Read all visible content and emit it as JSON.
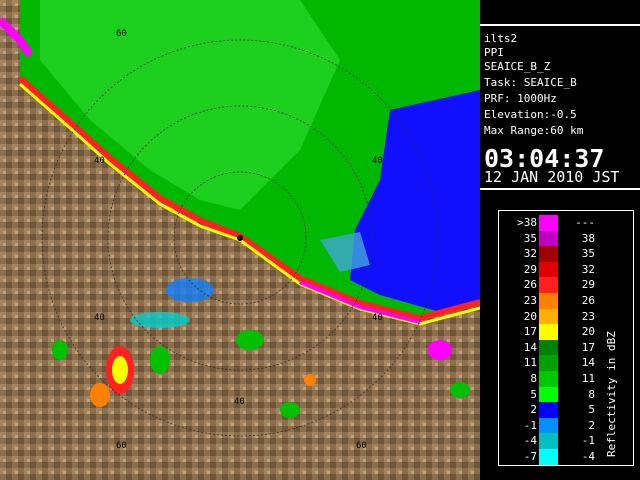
{
  "radar": {
    "range_rings": [
      "20",
      "40",
      "60"
    ]
  },
  "info": {
    "station": "ilts2",
    "scan_type": "PPI",
    "product": "SEAICE_B_Z",
    "task": "Task: SEAICE_B",
    "prf": "PRF: 1000Hz",
    "elevation": "Elevation:-0.5",
    "max_range": "Max Range:60 km",
    "time": "03:04:37",
    "date": "12 JAN 2010 JST"
  },
  "legend": {
    "title": "Reflectivity in dBZ",
    "rows": [
      {
        "low": ">38",
        "high": "---",
        "color": "#ff00ff"
      },
      {
        "low": "35",
        "high": "38",
        "color": "#c000c0"
      },
      {
        "low": "32",
        "high": "35",
        "color": "#a00000"
      },
      {
        "low": "29",
        "high": "32",
        "color": "#e00000"
      },
      {
        "low": "26",
        "high": "29",
        "color": "#ff2020"
      },
      {
        "low": "23",
        "high": "26",
        "color": "#ff8000"
      },
      {
        "low": "20",
        "high": "23",
        "color": "#ffb000"
      },
      {
        "low": "17",
        "high": "20",
        "color": "#ffff00"
      },
      {
        "low": "14",
        "high": "17",
        "color": "#008000"
      },
      {
        "low": "11",
        "high": "14",
        "color": "#00a000"
      },
      {
        "low": "8",
        "high": "11",
        "color": "#00c800"
      },
      {
        "low": "5",
        "high": "8",
        "color": "#00ff00"
      },
      {
        "low": "2",
        "high": "5",
        "color": "#0000ff"
      },
      {
        "low": "-1",
        "high": "2",
        "color": "#0090ff"
      },
      {
        "low": "-4",
        "high": "-1",
        "color": "#00c0c0"
      },
      {
        "low": "-7",
        "high": "-4",
        "color": "#00ffff"
      }
    ]
  }
}
